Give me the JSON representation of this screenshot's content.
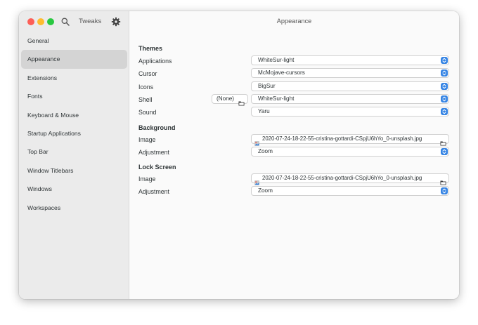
{
  "window": {
    "app_title": "Tweaks",
    "page_title": "Appearance"
  },
  "sidebar": {
    "items": [
      {
        "label": "General"
      },
      {
        "label": "Appearance"
      },
      {
        "label": "Extensions"
      },
      {
        "label": "Fonts"
      },
      {
        "label": "Keyboard & Mouse"
      },
      {
        "label": "Startup Applications"
      },
      {
        "label": "Top Bar"
      },
      {
        "label": "Window Titlebars"
      },
      {
        "label": "Windows"
      },
      {
        "label": "Workspaces"
      }
    ],
    "active_index": 1
  },
  "themes": {
    "title": "Themes",
    "applications": {
      "label": "Applications",
      "value": "WhiteSur-light"
    },
    "cursor": {
      "label": "Cursor",
      "value": "McMojave-cursors"
    },
    "icons": {
      "label": "Icons",
      "value": "BigSur"
    },
    "shell": {
      "label": "Shell",
      "file_value": "(None)",
      "value": "WhiteSur-light"
    },
    "sound": {
      "label": "Sound",
      "value": "Yaru"
    }
  },
  "background": {
    "title": "Background",
    "image": {
      "label": "Image",
      "value": "2020-07-24-18-22-55-cristina-gottardi-CSpjU6hYo_0-unsplash.jpg"
    },
    "adjustment": {
      "label": "Adjustment",
      "value": "Zoom"
    }
  },
  "lock_screen": {
    "title": "Lock Screen",
    "image": {
      "label": "Image",
      "value": "2020-07-24-18-22-55-cristina-gottardi-CSpjU6hYo_0-unsplash.jpg"
    },
    "adjustment": {
      "label": "Adjustment",
      "value": "Zoom"
    }
  },
  "colors": {
    "accent": "#3584e4",
    "close": "#fd5f57",
    "minimize": "#febc2e",
    "maximize": "#28c840"
  }
}
